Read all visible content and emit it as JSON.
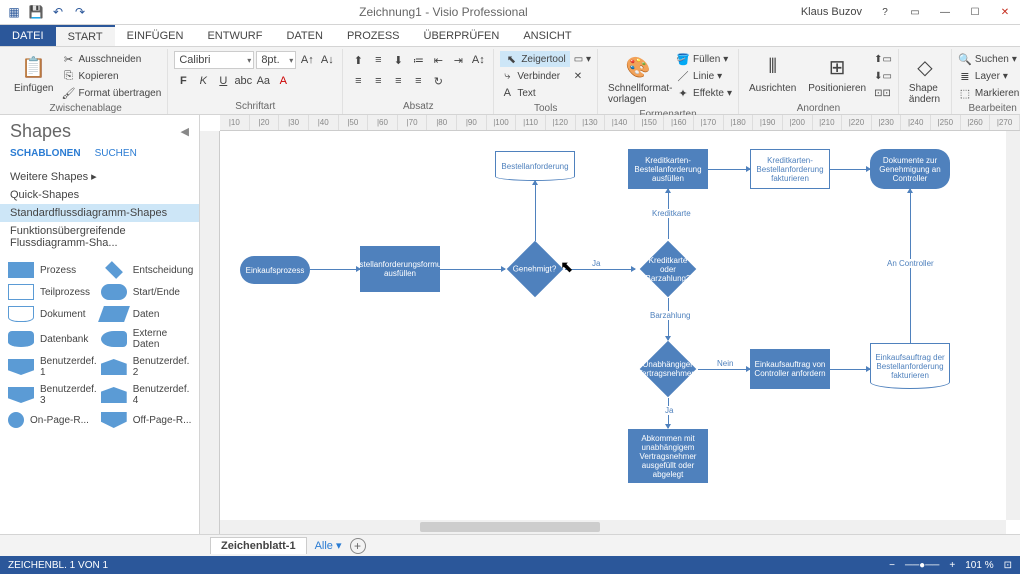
{
  "titlebar": {
    "title": "Zeichnung1 - Visio Professional",
    "user": "Klaus Buzov"
  },
  "ribbon": {
    "file": "DATEI",
    "tabs": [
      "START",
      "EINFÜGEN",
      "ENTWURF",
      "DATEN",
      "PROZESS",
      "ÜBERPRÜFEN",
      "ANSICHT"
    ],
    "clipboard": {
      "label": "Zwischenablage",
      "paste": "Einfügen",
      "cut": "Ausschneiden",
      "copy": "Kopieren",
      "format": "Format übertragen"
    },
    "font": {
      "label": "Schriftart",
      "name": "Calibri",
      "size": "8pt."
    },
    "paragraph": {
      "label": "Absatz"
    },
    "tools": {
      "label": "Tools",
      "pointer": "Zeigertool",
      "connector": "Verbinder",
      "text": "Text"
    },
    "quickstyles": {
      "label": "Formenarten",
      "btn": "Schnellformat-vorlagen",
      "fill": "Füllen",
      "line": "Linie",
      "effects": "Effekte"
    },
    "arrange": {
      "label": "Anordnen",
      "align": "Ausrichten",
      "position": "Positionieren"
    },
    "shapechange": {
      "btn": "Shape ändern"
    },
    "editing": {
      "label": "Bearbeiten",
      "find": "Suchen",
      "layer": "Layer",
      "select": "Markieren"
    }
  },
  "shapes": {
    "title": "Shapes",
    "tabs": {
      "stencils": "SCHABLONEN",
      "search": "SUCHEN"
    },
    "more": "Weitere Shapes",
    "quick": "Quick-Shapes",
    "stdflow": "Standardflussdiagramm-Shapes",
    "crossfunc": "Funktionsübergreifende Flussdiagramm-Sha...",
    "items": [
      {
        "label": "Prozess"
      },
      {
        "label": "Entscheidung"
      },
      {
        "label": "Teilprozess"
      },
      {
        "label": "Start/Ende"
      },
      {
        "label": "Dokument"
      },
      {
        "label": "Daten"
      },
      {
        "label": "Datenbank"
      },
      {
        "label": "Externe Daten"
      },
      {
        "label": "Benutzerdef. 1"
      },
      {
        "label": "Benutzerdef. 2"
      },
      {
        "label": "Benutzerdef. 3"
      },
      {
        "label": "Benutzerdef. 4"
      },
      {
        "label": "On-Page-R..."
      },
      {
        "label": "Off-Page-R..."
      }
    ]
  },
  "ruler": [
    "|10",
    "|20",
    "|30",
    "|40",
    "|50",
    "|60",
    "|70",
    "|80",
    "|90",
    "|100",
    "|110",
    "|120",
    "|130",
    "|140",
    "|150",
    "|160",
    "|170",
    "|180",
    "|190",
    "|200",
    "|210",
    "|220",
    "|230",
    "|240",
    "|250",
    "|260",
    "|270"
  ],
  "nodes": {
    "start": "Einkaufsprozess",
    "fillform": "Bestellanforderungsformular ausfüllen",
    "approved": "Genehmigt?",
    "orderreq": "Bestellanforderung",
    "cardorcash": "Kreditkarte oder Barzahlung?",
    "ccfill": "Kreditkarten-Bestellanforderung ausfüllen",
    "ccinvoice": "Kreditkarten-Bestellanforderung fakturieren",
    "docs": "Dokumente zur Genehmigung an Controller",
    "indep": "Unabhängiger Vertragsnehmer?",
    "reqctrl": "Einkaufsauftrag von Controller anfordern",
    "invoicereq": "Einkaufsauftrag der Bestellanforderung fakturieren",
    "agreement": "Abkommen mit unabhängigem Vertragsnehmer ausgefüllt oder abgelegt"
  },
  "labels": {
    "yes": "Ja",
    "cc": "Kreditkarte",
    "cash": "Barzahlung",
    "no": "Nein",
    "toctrl": "An Controller"
  },
  "pagetabs": {
    "page1": "Zeichenblatt-1",
    "all": "Alle"
  },
  "status": {
    "left": "ZEICHENBL. 1 VON 1",
    "zoom": "101 %"
  }
}
